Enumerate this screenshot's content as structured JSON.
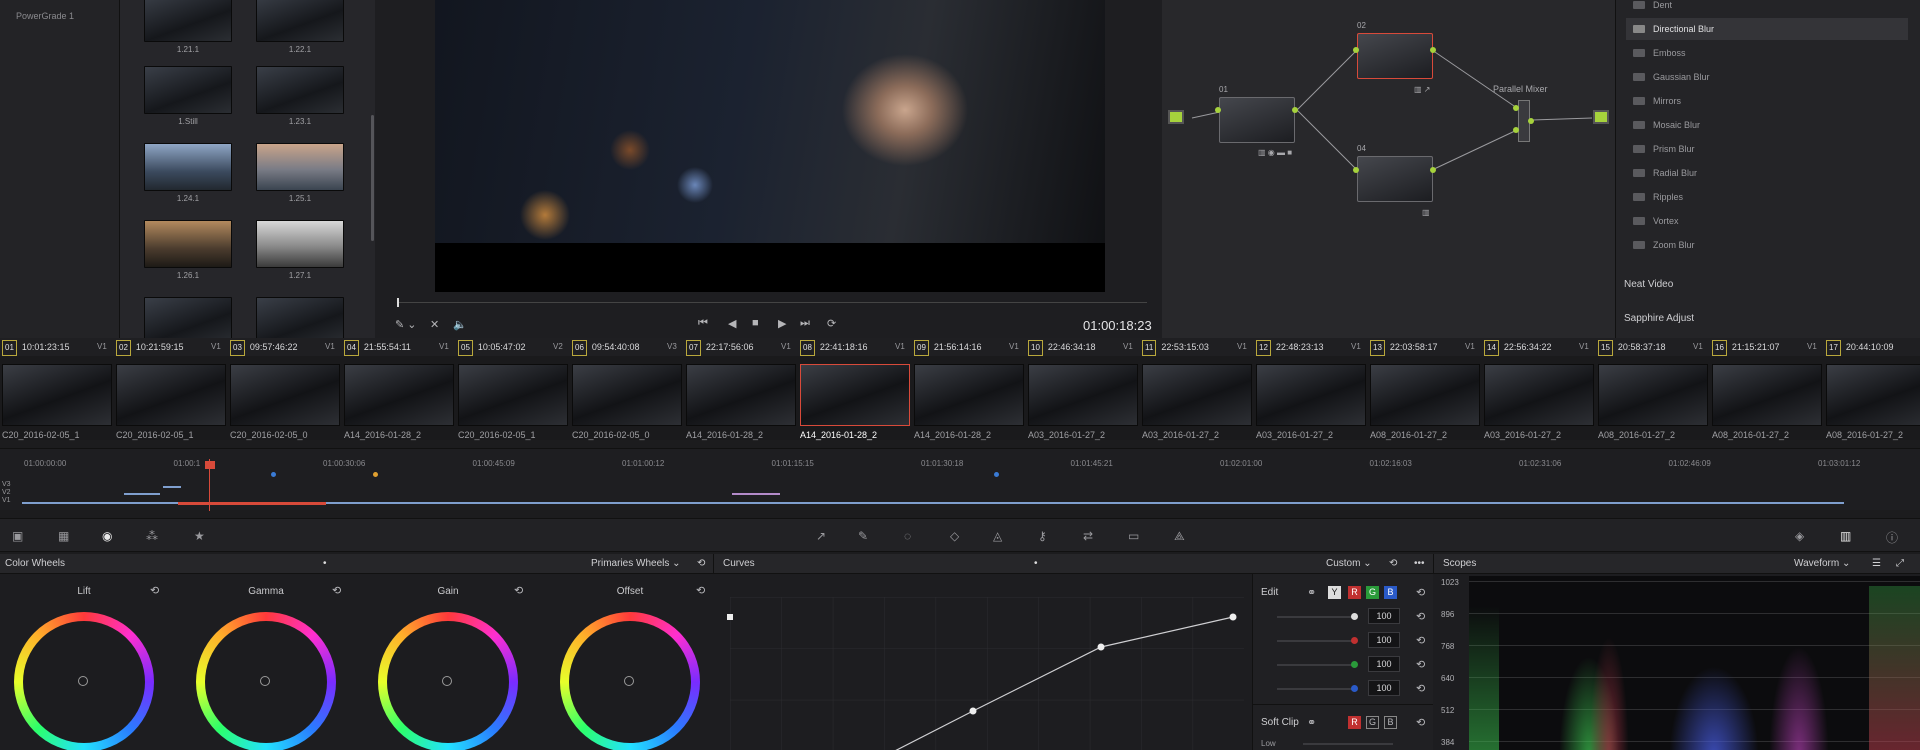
{
  "gallery": {
    "item": "PowerGrade 1"
  },
  "stills": [
    {
      "label": "1.21.1"
    },
    {
      "label": "1.22.1"
    },
    {
      "label": "1.Still"
    },
    {
      "label": "1.23.1"
    },
    {
      "label": "1.24.1"
    },
    {
      "label": "1.25.1"
    },
    {
      "label": "1.26.1"
    },
    {
      "label": "1.27.1"
    }
  ],
  "viewer": {
    "timecode": "01:00:18:23"
  },
  "nodes": {
    "n01": "01",
    "n02": "02",
    "n04": "04",
    "mixer": "Parallel Mixer"
  },
  "fx": {
    "items": [
      "Dent",
      "Directional Blur",
      "Emboss",
      "Gaussian Blur",
      "Mirrors",
      "Mosaic Blur",
      "Prism Blur",
      "Radial Blur",
      "Ripples",
      "Vortex",
      "Zoom Blur"
    ],
    "selected": "Directional Blur",
    "group1": "Neat Video",
    "group2": "Sapphire Adjust"
  },
  "clips": [
    {
      "num": "01",
      "tc": "10:01:23:15",
      "track": "V1",
      "name": "C20_2016-02-05_1"
    },
    {
      "num": "02",
      "tc": "10:21:59:15",
      "track": "V1",
      "name": "C20_2016-02-05_1"
    },
    {
      "num": "03",
      "tc": "09:57:46:22",
      "track": "V1",
      "name": "C20_2016-02-05_0"
    },
    {
      "num": "04",
      "tc": "21:55:54:11",
      "track": "V1",
      "name": "A14_2016-01-28_2"
    },
    {
      "num": "05",
      "tc": "10:05:47:02",
      "track": "V2",
      "name": "C20_2016-02-05_1"
    },
    {
      "num": "06",
      "tc": "09:54:40:08",
      "track": "V3",
      "name": "C20_2016-02-05_0"
    },
    {
      "num": "07",
      "tc": "22:17:56:06",
      "track": "V1",
      "name": "A14_2016-01-28_2"
    },
    {
      "num": "08",
      "tc": "22:41:18:16",
      "track": "V1",
      "name": "A14_2016-01-28_2"
    },
    {
      "num": "09",
      "tc": "21:56:14:16",
      "track": "V1",
      "name": "A14_2016-01-28_2"
    },
    {
      "num": "10",
      "tc": "22:46:34:18",
      "track": "V1",
      "name": "A03_2016-01-27_2"
    },
    {
      "num": "11",
      "tc": "22:53:15:03",
      "track": "V1",
      "name": "A03_2016-01-27_2"
    },
    {
      "num": "12",
      "tc": "22:48:23:13",
      "track": "V1",
      "name": "A03_2016-01-27_2"
    },
    {
      "num": "13",
      "tc": "22:03:58:17",
      "track": "V1",
      "name": "A08_2016-01-27_2"
    },
    {
      "num": "14",
      "tc": "22:56:34:22",
      "track": "V1",
      "name": "A03_2016-01-27_2"
    },
    {
      "num": "15",
      "tc": "20:58:37:18",
      "track": "V1",
      "name": "A08_2016-01-27_2"
    },
    {
      "num": "16",
      "tc": "21:15:21:07",
      "track": "V1",
      "name": "A08_2016-01-27_2"
    },
    {
      "num": "17",
      "tc": "20:44:10:09",
      "track": "",
      "name": "A08_2016-01-27_2"
    }
  ],
  "ruler": [
    "01:00:00:00",
    "01:00:1",
    "01:00:30:06",
    "01:00:45:09",
    "01:01:00:12",
    "01:01:15:15",
    "01:01:30:18",
    "01:01:45:21",
    "01:02:01:00",
    "01:02:16:03",
    "01:02:31:06",
    "01:02:46:09",
    "01:03:01:12"
  ],
  "tracks": [
    "V3",
    "V2",
    "V1"
  ],
  "colorWheels": {
    "title": "Color Wheels",
    "mode": "Primaries Wheels",
    "wheels": [
      "Lift",
      "Gamma",
      "Gain",
      "Offset"
    ]
  },
  "curves": {
    "title": "Curves",
    "mode": "Custom"
  },
  "edit": {
    "label": "Edit",
    "channels": [
      "Y",
      "R",
      "G",
      "B"
    ],
    "values": [
      "100",
      "100",
      "100",
      "100"
    ],
    "softclip": "Soft Clip",
    "low": "Low"
  },
  "scopes": {
    "title": "Scopes",
    "mode": "Waveform",
    "ticks": [
      "1023",
      "896",
      "768",
      "640",
      "512",
      "384"
    ]
  }
}
